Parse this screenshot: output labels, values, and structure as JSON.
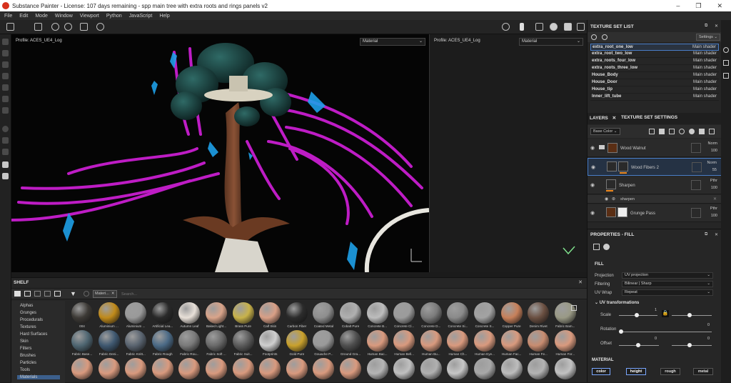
{
  "window": {
    "title": "Substance Painter - License: 107 days remaining - spp main tree with extra roots and rings panels v2",
    "minimize": "–",
    "maximize": "❐",
    "close": "✕"
  },
  "menu": [
    "File",
    "Edit",
    "Mode",
    "Window",
    "Viewport",
    "Python",
    "JavaScript",
    "Help"
  ],
  "viewport": {
    "profile_left": "Profile: ACES_UE4_Log",
    "mode_left": "Material",
    "profile_right": "Profile: ACES_UE4_Log",
    "mode_right": "Material"
  },
  "shelf": {
    "title": "SHELF",
    "filter_tag": "Materi...",
    "search_placeholder": "Search...",
    "categories": [
      "Alphas",
      "Grunges",
      "Procedurals",
      "Textures",
      "Hard Surfaces",
      "Skin",
      "Filters",
      "Brushes",
      "Particles",
      "Tools",
      "Materials"
    ],
    "row1": [
      {
        "name": "004",
        "color": "#3d3a36"
      },
      {
        "name": "Aluminium ...",
        "color": "#c08a1a"
      },
      {
        "name": "Aluminium ...",
        "color": "#9a9a9a"
      },
      {
        "name": "Artificial Lea...",
        "color": "#2a2a2a"
      },
      {
        "name": "Autumn Leaf",
        "color": "#e8e0d8"
      },
      {
        "name": "Baked Light...",
        "color": "#d9a48a"
      },
      {
        "name": "Brass Pure",
        "color": "#c8b24a"
      },
      {
        "name": "Calf Skin",
        "color": "#d99f86"
      },
      {
        "name": "Carbon Fiber",
        "color": "#2c2c2c"
      },
      {
        "name": "Coated Metal",
        "color": "#8e8e8e"
      },
      {
        "name": "Cobalt Pure",
        "color": "#b0b0b0"
      },
      {
        "name": "Concrete B...",
        "color": "#bdbdbd"
      },
      {
        "name": "Concrete Cl...",
        "color": "#9c9c9c"
      },
      {
        "name": "Concrete D...",
        "color": "#7b7b7b"
      },
      {
        "name": "Concrete Si...",
        "color": "#8a8a8a"
      },
      {
        "name": "Concrete S...",
        "color": "#a3a3a3"
      },
      {
        "name": "Copper Pure",
        "color": "#c7805a"
      },
      {
        "name": "Denim Rivet",
        "color": "#6b5042"
      },
      {
        "name": "Fabric Bam...",
        "color": "#9a9a86"
      }
    ],
    "row2": [
      {
        "name": "Fabric Base...",
        "color": "#4f6672"
      },
      {
        "name": "Fabric Deni...",
        "color": "#3f5870"
      },
      {
        "name": "Fabric Knitt...",
        "color": "#5a6470"
      },
      {
        "name": "Fabric Rough",
        "color": "#4b6a86"
      },
      {
        "name": "Fabric Rou...",
        "color": "#7a7a7a"
      },
      {
        "name": "Fabric Soft ...",
        "color": "#6a6a6a"
      },
      {
        "name": "Fabric Suit...",
        "color": "#5b5b5b"
      },
      {
        "name": "Footprints",
        "color": "#cfcfcf"
      },
      {
        "name": "Gold Pure",
        "color": "#c9a12c"
      },
      {
        "name": "Gouache P...",
        "color": "#9a9a9a"
      },
      {
        "name": "Ground Gra...",
        "color": "#4f4f4f"
      },
      {
        "name": "Human Bac...",
        "color": "#d99a7e"
      },
      {
        "name": "Human Bell...",
        "color": "#d99a7e"
      },
      {
        "name": "Human Bu...",
        "color": "#d99a7e"
      },
      {
        "name": "Human Ch...",
        "color": "#d99a7e"
      },
      {
        "name": "Human Eye...",
        "color": "#d99a7e"
      },
      {
        "name": "Human Fac...",
        "color": "#d99a7e"
      },
      {
        "name": "Human Fe...",
        "color": "#c88c70"
      },
      {
        "name": "Human For...",
        "color": "#d99a7e"
      }
    ],
    "row3": [
      "#d99a7e",
      "#d99a7e",
      "#d99a7e",
      "#d99a7e",
      "#d99a7e",
      "#d99a7e",
      "#d99a7e",
      "#d99a7e",
      "#d99a7e",
      "#d99a7e",
      "#d99a7e",
      "#b5b5b5",
      "#c0c0c0",
      "#b0b0b0",
      "#c6c6c6",
      "#a8a8a8",
      "#bdbdbd",
      "#b3b3b3",
      "#c2c2c2"
    ]
  },
  "texture_set_list": {
    "title": "TEXTURE SET LIST",
    "settings_label": "Settings",
    "items": [
      {
        "name": "extra_root_one_low",
        "shader": "Main shader"
      },
      {
        "name": "extra_root_two_low",
        "shader": "Main shader"
      },
      {
        "name": "extra_roots_four_low",
        "shader": "Main shader"
      },
      {
        "name": "extra_roots_three_low",
        "shader": "Main shader"
      },
      {
        "name": "House_Body",
        "shader": "Main shader"
      },
      {
        "name": "House_Door",
        "shader": "Main shader"
      },
      {
        "name": "House_tip",
        "shader": "Main shader"
      },
      {
        "name": "Inner_lift_tube",
        "shader": "Main shader"
      }
    ]
  },
  "layers": {
    "tab_layers": "LAYERS",
    "tab_close": "✕",
    "tab_tss": "TEXTURE SET SETTINGS",
    "channel": "Base Color",
    "items": [
      {
        "name": "Wood Walnut",
        "blend": "Norm",
        "opacity": "100"
      },
      {
        "name": "Wood Fibers 2",
        "blend": "Norm",
        "opacity": "55"
      },
      {
        "name": "Sharpen",
        "blend": "Pthr",
        "opacity": "100"
      },
      {
        "name": "sharpen",
        "blend": "",
        "opacity": ""
      },
      {
        "name": "Grunge Pass",
        "blend": "Pthr",
        "opacity": "100"
      }
    ]
  },
  "properties": {
    "title": "PROPERTIES - FILL",
    "section_fill": "FILL",
    "projection_label": "Projection",
    "projection_value": "UV projection",
    "filtering_label": "Filtering",
    "filtering_value": "Bilinear | Sharp",
    "uvwrap_label": "UV Wrap",
    "uvwrap_value": "Repeat",
    "uv_transformations": "UV transformations",
    "scale_label": "Scale",
    "scale_value": "1",
    "rotation_label": "Rotation",
    "rotation_value": "0",
    "offset_label": "Offset",
    "offset_x": "0",
    "offset_y": "0",
    "section_material": "MATERIAL",
    "channels": [
      "color",
      "height",
      "rough",
      "metal"
    ]
  },
  "colors": {
    "accent_blue": "#4a7ec8",
    "neon_magenta": "#c81ed0",
    "crystal_cyan": "#1ea0e8",
    "leaf_teal": "#1f4a48"
  }
}
